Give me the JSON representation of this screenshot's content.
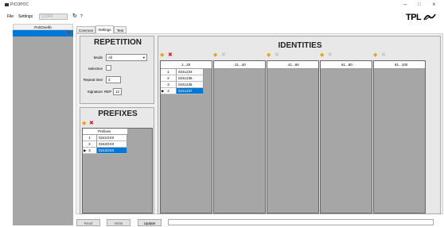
{
  "window": {
    "title": "PICOPOC",
    "minimize": "–",
    "maximize": "□",
    "close": "×"
  },
  "menu": {
    "file": "File",
    "settings": "Settings",
    "com": "COM3",
    "refresh_icon": "↻",
    "help": "?"
  },
  "logo": "TPL",
  "left_panel": {
    "header": "PortOverlb"
  },
  "tabs": [
    "Common",
    "Settings",
    "Test"
  ],
  "repetition": {
    "title": "REPETITION",
    "mode_label": "Mode",
    "mode_value": "All",
    "selective_label": "Selective",
    "repeat_label": "Repeat time",
    "repeat_value": "3",
    "signature_label": "Signature",
    "signature_prefix": "REP",
    "signature_value": "12"
  },
  "prefixes": {
    "title": "PREFIXES",
    "column": "Prefixes",
    "rows": [
      {
        "n": "1",
        "v": "0241OXX"
      },
      {
        "n": "2",
        "v": "0242OXX"
      },
      {
        "n": "3",
        "v": "0243OXX"
      }
    ]
  },
  "identities": {
    "title": "IDENTITIES",
    "columns": [
      {
        "range": "1...20",
        "rows": [
          {
            "n": "1",
            "v": "0241234"
          },
          {
            "n": "2",
            "v": "0241235"
          },
          {
            "n": "3",
            "v": "0241236"
          },
          {
            "n": "4",
            "v": "0241237"
          }
        ]
      },
      {
        "range": "21...40",
        "rows": []
      },
      {
        "range": "41...60",
        "rows": []
      },
      {
        "range": "61...80",
        "rows": []
      },
      {
        "range": "81...100",
        "rows": []
      }
    ]
  },
  "buttons": {
    "read": "Read",
    "write": "Write",
    "update": "Update"
  }
}
